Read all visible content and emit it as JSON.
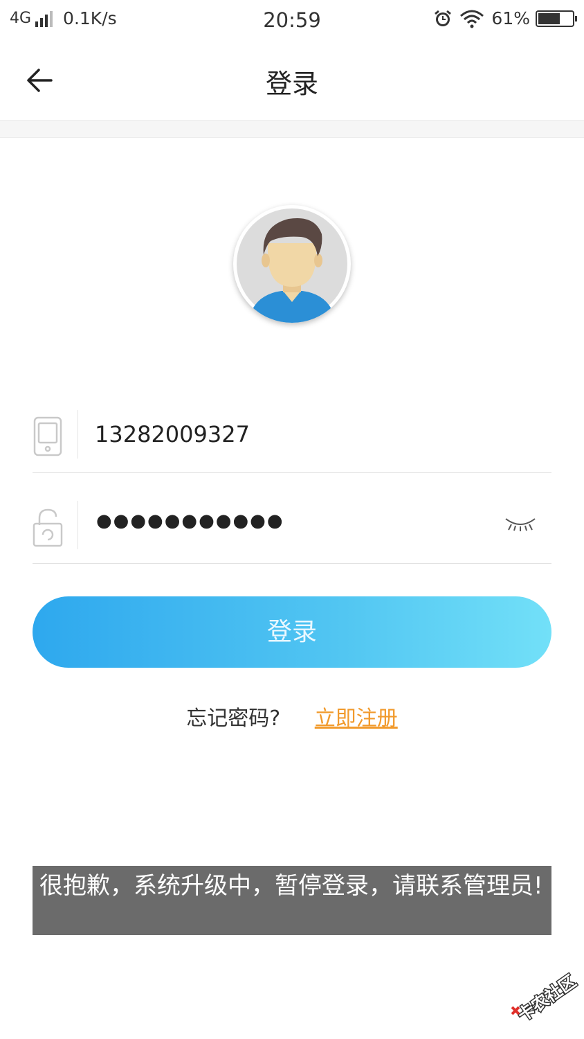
{
  "status_bar": {
    "network": "4G",
    "speed": "0.1K/s",
    "time": "20:59",
    "battery": "61%"
  },
  "nav": {
    "title": "登录"
  },
  "form": {
    "phone_value": "13282009327",
    "password_mask": "●●●●●●●●●●●"
  },
  "login_button": {
    "label": "登录"
  },
  "links": {
    "forgot": "忘记密码?",
    "register": "立即注册"
  },
  "toast": {
    "message": "很抱歉，系统升级中，暂停登录，请联系管理员!"
  },
  "watermark": {
    "text": "卡农社区"
  },
  "colors": {
    "accent_start": "#2ea8ee",
    "accent_end": "#72e0f8",
    "link": "#f19a2c",
    "toast_bg": "#6b6b6b"
  }
}
